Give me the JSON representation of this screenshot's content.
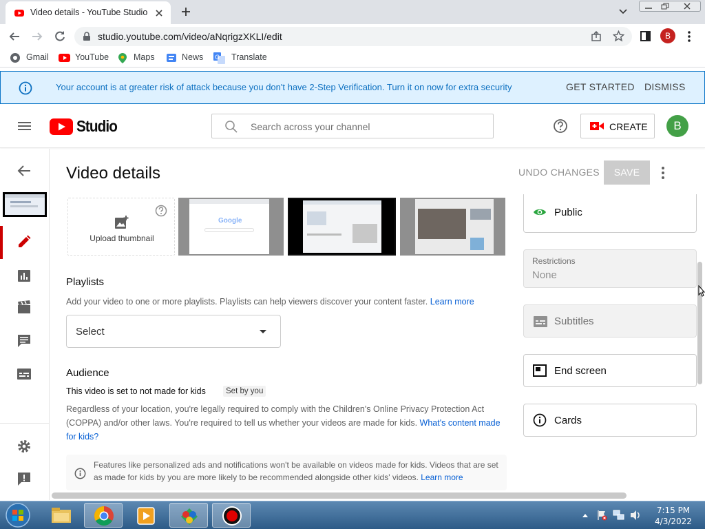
{
  "browser": {
    "tab_title": "Video details - YouTube Studio",
    "url": "studio.youtube.com/video/aNqrigzXKLI/edit",
    "profile_initial": "B",
    "bookmarks": [
      "Gmail",
      "YouTube",
      "Maps",
      "News",
      "Translate"
    ]
  },
  "banner": {
    "message": "Your account is at greater risk of attack because you don't have 2-Step Verification. Turn it on now for extra security",
    "get_started": "GET STARTED",
    "dismiss": "DISMISS"
  },
  "header": {
    "logo_text": "Studio",
    "search_placeholder": "Search across your channel",
    "create_label": "CREATE",
    "avatar_initial": "B"
  },
  "page": {
    "title": "Video details",
    "undo_label": "UNDO CHANGES",
    "save_label": "SAVE"
  },
  "thumbnails": {
    "upload_label": "Upload thumbnail",
    "preview_text": "Google"
  },
  "playlists": {
    "heading": "Playlists",
    "description": "Add your video to one or more playlists. Playlists can help viewers discover your content faster.",
    "learn_more": "Learn more",
    "select_value": "Select"
  },
  "audience": {
    "heading": "Audience",
    "status": "This video is set to not made for kids",
    "badge": "Set by you",
    "description": "Regardless of your location, you're legally required to comply with the Children's Online Privacy Protection Act (COPPA) and/or other laws. You're required to tell us whether your videos are made for kids.",
    "link": "What's content made for kids?",
    "notice": "Features like personalized ads and notifications won't be available on videos made for kids. Videos that are set as made for kids by you are more likely to be recommended alongside other kids' videos.",
    "notice_link": "Learn more"
  },
  "sidebar_right": {
    "visibility": "Public",
    "restrictions_label": "Restrictions",
    "restrictions_value": "None",
    "subtitles": "Subtitles",
    "end_screen": "End screen",
    "cards": "Cards"
  },
  "taskbar": {
    "time": "7:15 PM",
    "date": "4/3/2022"
  },
  "colors": {
    "youtube_red": "#ff0000",
    "link_blue": "#065fd4",
    "banner_bg": "#def1ff",
    "avatar_green": "#43a047"
  }
}
